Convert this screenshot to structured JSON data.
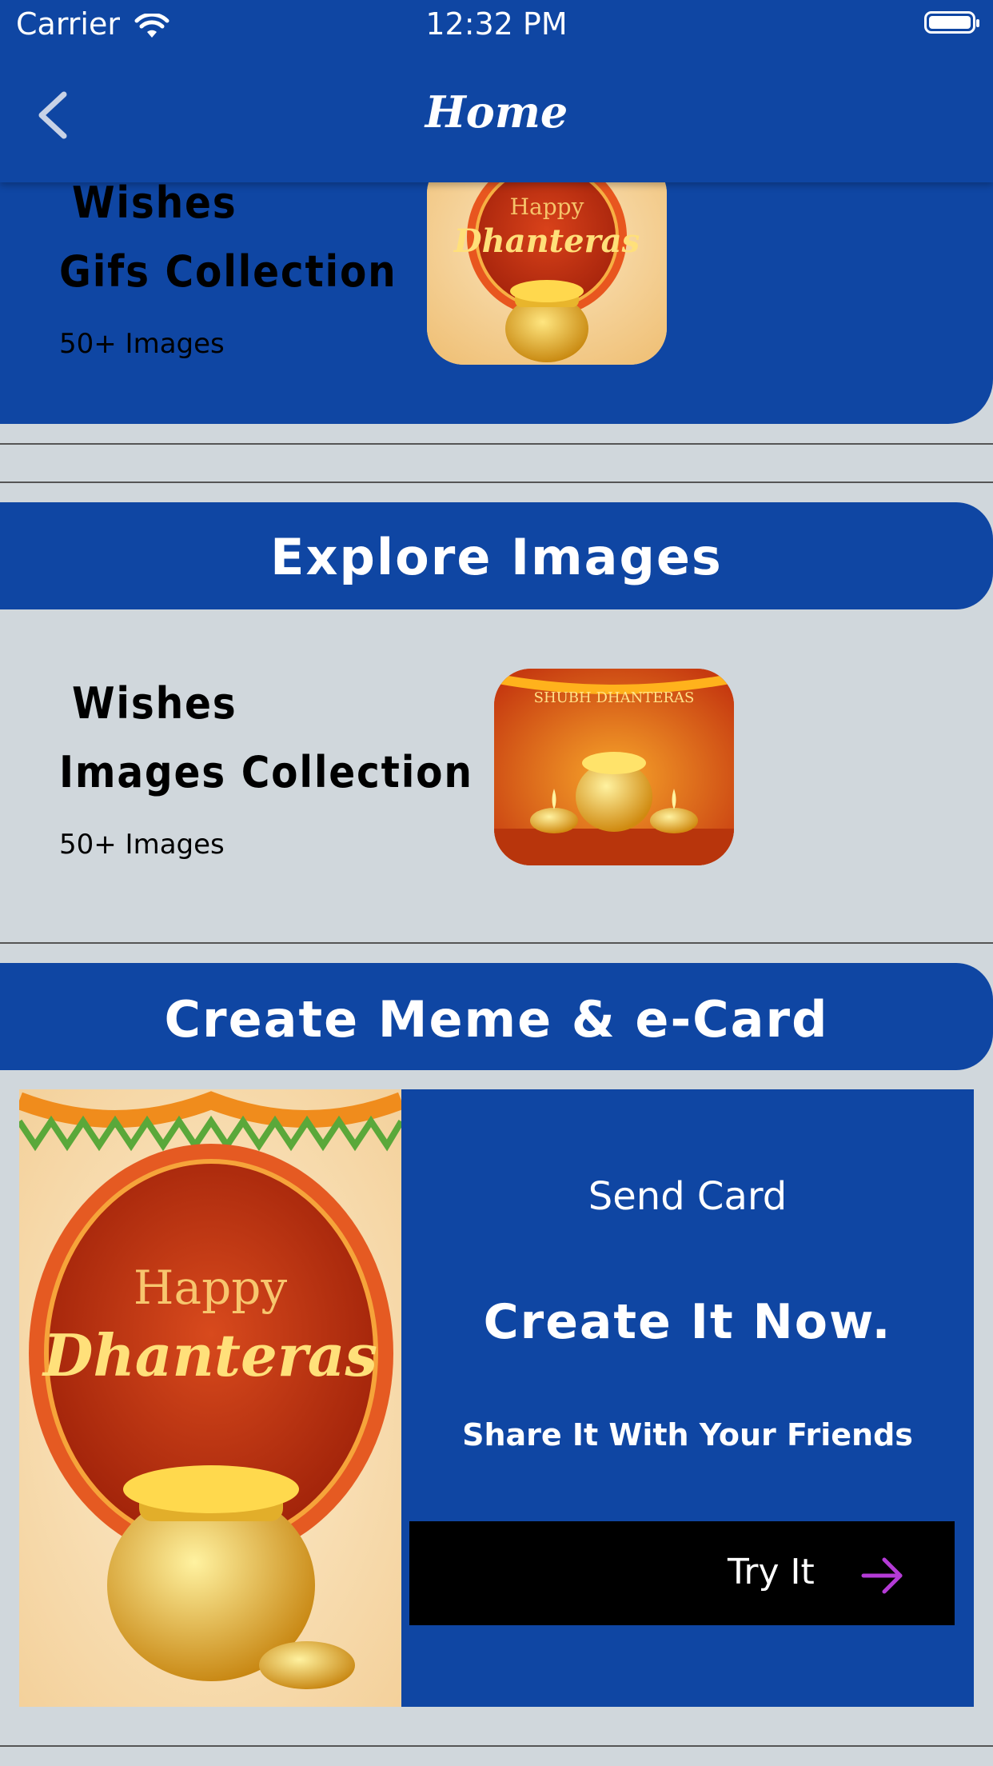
{
  "status_bar": {
    "carrier": "Carrier",
    "time": "12:32 PM"
  },
  "nav": {
    "title": "Home"
  },
  "gifs_section": {
    "title_line1": "Wishes",
    "title_line2": "Gifs Collection",
    "count": "50+ Images",
    "thumb_text_top": "Happy",
    "thumb_text_main": "Dhanteras"
  },
  "images_section": {
    "header": "Explore Images",
    "title_line1": "Wishes",
    "title_line2": "Images Collection",
    "count": "50+ Images",
    "thumb_text": "SHUBH DHANTERAS"
  },
  "ecard_section": {
    "header": "Create  Meme & e-Card",
    "image_text_top": "Happy",
    "image_text_main": "Dhanteras",
    "send_card": "Send  Card",
    "create_now": "Create It Now.",
    "share_text": "Share It With Your Friends",
    "try_label": "Try It"
  },
  "colors": {
    "primary": "#0f46a3",
    "background": "#d0d7dc",
    "arrow": "#b43bd6"
  }
}
